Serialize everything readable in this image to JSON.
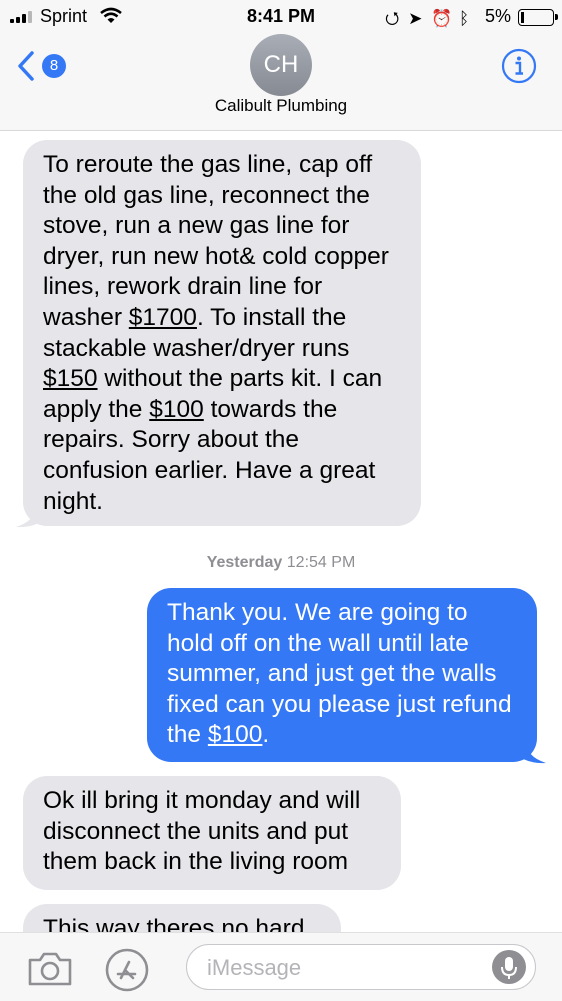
{
  "status_bar": {
    "carrier": "Sprint",
    "time": "8:41 PM",
    "battery": "5%"
  },
  "header": {
    "back_badge": "8",
    "avatar_initials": "CH",
    "contact_name": "Calibult Plumbing"
  },
  "messages": [
    {
      "direction": "incoming",
      "parts": [
        "To reroute the gas line, cap off the old gas line, reconnect the stove, run a new gas line for dryer, run new hot& cold copper lines, rework drain line for washer ",
        "$1700",
        ". To install the stackable washer/dryer runs ",
        "$150",
        " without the parts kit. I can apply the ",
        "$100",
        " towards the repairs. Sorry about the confusion earlier. Have a great night."
      ]
    },
    {
      "direction": "outgoing",
      "parts": [
        "Thank you. We are going to hold off on the wall until late summer, and just get the walls fixed can you please just refund the ",
        "$100",
        "."
      ]
    },
    {
      "direction": "incoming",
      "text": "Ok ill bring it monday and will disconnect the units and put them back in the living room"
    },
    {
      "direction": "incoming",
      "text": "This way theres no hard"
    }
  ],
  "timestamp": {
    "day": "Yesterday",
    "time": "12:54 PM"
  },
  "input": {
    "placeholder": "iMessage"
  },
  "colors": {
    "accent": "#3478f6",
    "incoming_bubble": "#e5e5ea",
    "outgoing_bubble": "#3478f6"
  },
  "icons": [
    "signal-icon",
    "wifi-icon",
    "lock-rotation-icon",
    "location-icon",
    "alarm-icon",
    "bluetooth-icon",
    "battery-icon",
    "back-chevron-icon",
    "info-icon",
    "camera-icon",
    "app-store-icon",
    "microphone-icon"
  ]
}
